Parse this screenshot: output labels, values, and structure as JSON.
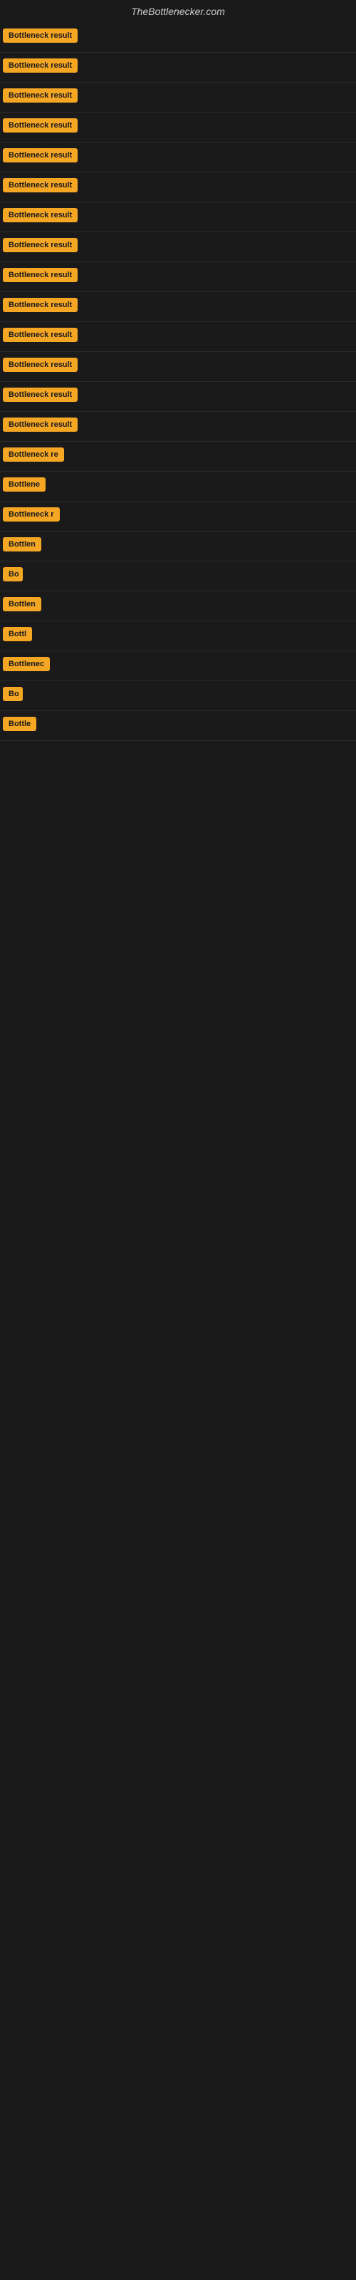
{
  "site": {
    "title": "TheBottlenecker.com"
  },
  "results": [
    {
      "id": 1,
      "label": "Bottleneck result",
      "width": 120
    },
    {
      "id": 2,
      "label": "Bottleneck result",
      "width": 120
    },
    {
      "id": 3,
      "label": "Bottleneck result",
      "width": 120
    },
    {
      "id": 4,
      "label": "Bottleneck result",
      "width": 120
    },
    {
      "id": 5,
      "label": "Bottleneck result",
      "width": 120
    },
    {
      "id": 6,
      "label": "Bottleneck result",
      "width": 120
    },
    {
      "id": 7,
      "label": "Bottleneck result",
      "width": 120
    },
    {
      "id": 8,
      "label": "Bottleneck result",
      "width": 120
    },
    {
      "id": 9,
      "label": "Bottleneck result",
      "width": 120
    },
    {
      "id": 10,
      "label": "Bottleneck result",
      "width": 120
    },
    {
      "id": 11,
      "label": "Bottleneck result",
      "width": 120
    },
    {
      "id": 12,
      "label": "Bottleneck result",
      "width": 120
    },
    {
      "id": 13,
      "label": "Bottleneck result",
      "width": 120
    },
    {
      "id": 14,
      "label": "Bottleneck result",
      "width": 120
    },
    {
      "id": 15,
      "label": "Bottleneck re",
      "width": 90
    },
    {
      "id": 16,
      "label": "Bottlene",
      "width": 70
    },
    {
      "id": 17,
      "label": "Bottleneck r",
      "width": 85
    },
    {
      "id": 18,
      "label": "Bottlen",
      "width": 60
    },
    {
      "id": 19,
      "label": "Bo",
      "width": 28
    },
    {
      "id": 20,
      "label": "Bottlen",
      "width": 60
    },
    {
      "id": 21,
      "label": "Bottl",
      "width": 48
    },
    {
      "id": 22,
      "label": "Bottlenec",
      "width": 75
    },
    {
      "id": 23,
      "label": "Bo",
      "width": 28
    },
    {
      "id": 24,
      "label": "Bottle",
      "width": 52
    }
  ]
}
